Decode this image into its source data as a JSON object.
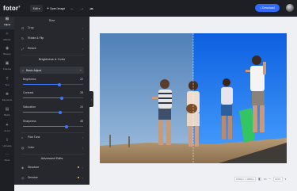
{
  "topbar": {
    "logo": "fotor",
    "logo_mark": "®",
    "edit_label": "Edit",
    "open_image_label": "Open Image",
    "download_label": "Download"
  },
  "rail": [
    {
      "icon": "adjust-icon",
      "glyph": "⊞",
      "label": "Adjust"
    },
    {
      "icon": "effects-icon",
      "glyph": "✧",
      "label": "Effects"
    },
    {
      "icon": "beauty-icon",
      "glyph": "◉",
      "label": "Beauty"
    },
    {
      "icon": "frames-icon",
      "glyph": "▣",
      "label": "Frames"
    },
    {
      "icon": "text-icon",
      "glyph": "T",
      "label": "Text"
    },
    {
      "icon": "elements-icon",
      "glyph": "❀",
      "label": "Elements"
    },
    {
      "icon": "batch-icon",
      "glyph": "▤",
      "label": "Batch"
    },
    {
      "icon": "ai-art-icon",
      "glyph": "✦",
      "label": "AI Art"
    },
    {
      "icon": "uploads-icon",
      "glyph": "⇪",
      "label": "Uploads"
    },
    {
      "icon": "more-icon",
      "glyph": "⋯",
      "label": "More"
    }
  ],
  "panel": {
    "size_title": "Size",
    "size_items": [
      {
        "label": "Crop",
        "glyph": "⊡"
      },
      {
        "label": "Rotate & Flip",
        "glyph": "↻"
      },
      {
        "label": "Resize",
        "glyph": "⤢"
      }
    ],
    "brightness_title": "Brightness & Color",
    "basic_adjust_label": "Basic Adjust",
    "sliders": [
      {
        "label": "Brightness",
        "value": "22",
        "fraction": 0.61
      },
      {
        "label": "Contrast",
        "value": "28",
        "fraction": 0.64
      },
      {
        "label": "Saturation",
        "value": "24",
        "fraction": 0.62
      },
      {
        "label": "Sharpness",
        "value": "45",
        "fraction": 0.72
      }
    ],
    "tone_items": [
      {
        "label": "Fine Tune",
        "glyph": "◐"
      },
      {
        "label": "Color",
        "glyph": "◍"
      }
    ],
    "advanced_title": "Advanced Edits",
    "advanced_items": [
      {
        "label": "Structure",
        "glyph": "◈"
      },
      {
        "label": "Denoise",
        "glyph": "◎"
      }
    ]
  },
  "bottom": {
    "size_text": "1000px × 1000px",
    "zoom_text": "100%"
  },
  "colors": {
    "accent": "#2f6bff",
    "slider": "#3a7bff",
    "panel_bg": "#26282e",
    "rail_bg": "#1e1f24",
    "pro_dot": "#f5c33b"
  }
}
